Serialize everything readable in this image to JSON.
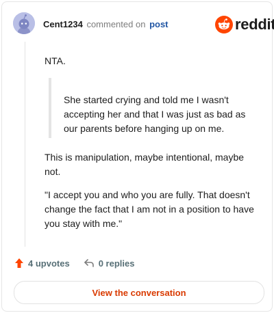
{
  "header": {
    "username": "Cent1234",
    "commented_on": "commented on",
    "post_link": "post",
    "brand": "reddit"
  },
  "comment": {
    "paragraph1": "NTA.",
    "quote": "She started crying and told me I wasn't accepting her and that I was just as bad as our parents before hanging up on me.",
    "paragraph2": "This is manipulation, maybe intentional, maybe not.",
    "paragraph3": "\"I accept you and who you are fully. That doesn't change the fact that I am not in a position to have you stay with me.\""
  },
  "actions": {
    "upvotes": "4 upvotes",
    "replies": "0 replies",
    "view_button": "View the conversation"
  },
  "icons": {
    "avatar": "snoo-avatar-icon",
    "logo": "reddit-logo-icon",
    "upvote": "upvote-arrow-icon",
    "reply": "reply-arrow-icon"
  },
  "colors": {
    "brand_orange": "#ff4500",
    "link_blue": "#2156a4",
    "button_text": "#d93a00"
  }
}
